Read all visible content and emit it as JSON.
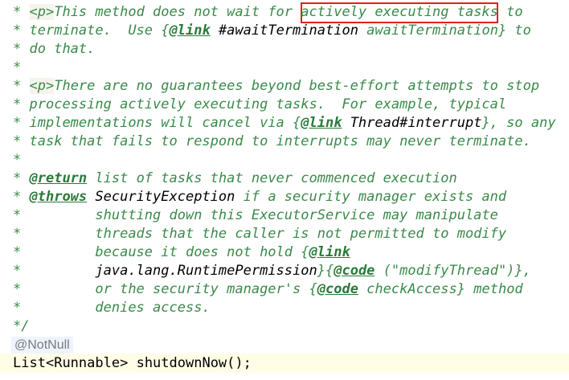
{
  "comment": {
    "l1": {
      "star": "*",
      "tag": "<p>",
      "text_before": "This method does not wait for ",
      "highlight": "actively executing tasks",
      "text_after": " to"
    },
    "l2": {
      "star": "*",
      "text": "terminate.  Use ",
      "brace_open": "{",
      "link": "@link",
      "ref": " #awaitTermination",
      "rest": " awaitTermination",
      "brace_close": "}",
      "after": " to"
    },
    "l3": {
      "star": "*",
      "text": "do that."
    },
    "l4": {
      "star": "*"
    },
    "l5": {
      "star": "*",
      "tag": "<p>",
      "text": "There are no guarantees beyond best-effort attempts to stop"
    },
    "l6": {
      "star": "*",
      "text": "processing actively executing tasks.  For example, typical"
    },
    "l7": {
      "star": "*",
      "text": "implementations will cancel via ",
      "brace_open": "{",
      "link": "@link",
      "ref": " Thread#interrupt",
      "brace_close": "}",
      "after": ", so any"
    },
    "l8": {
      "star": "*",
      "text": "task that fails to respond to interrupts may never terminate."
    },
    "l9": {
      "star": "*"
    },
    "l10": {
      "star": "*",
      "tag": "@return",
      "text": " list of tasks that never commenced execution"
    },
    "l11": {
      "star": "*",
      "tag": "@throws",
      "ref": " SecurityException",
      "text": " if a security manager exists and"
    },
    "l12": {
      "star": "*",
      "text": "        shutting down this ExecutorService may manipulate"
    },
    "l13": {
      "star": "*",
      "text": "        threads that the caller is not permitted to modify"
    },
    "l14": {
      "star": "*",
      "text": "        because it does not hold ",
      "brace_open": "{",
      "link": "@link"
    },
    "l15": {
      "star": "*",
      "ref": "        java.lang.RuntimePermission",
      "brace_close": "}",
      "brace_open": "{",
      "code": "@code",
      "code_text": " (\"modifyThread\")",
      "brace_close2": "}",
      "after": ","
    },
    "l16": {
      "star": "*",
      "text": "        or the security manager's ",
      "brace_open": "{",
      "code": "@code",
      "code_text": " checkAccess",
      "brace_close": "}",
      "after": " method"
    },
    "l17": {
      "star": "*",
      "text": "        denies access."
    },
    "l18": {
      "end": "*/"
    }
  },
  "annotation": "@NotNull",
  "signature": {
    "type": "List",
    "generic_open": "<",
    "generic": "Runnable",
    "generic_close": ">",
    "method": " shutdownNow",
    "parens": "()",
    "semicolon": ";"
  },
  "colors": {
    "comment": "#3a8a4a",
    "highlight_border": "#e0201e",
    "current_line": "#fffde6"
  }
}
